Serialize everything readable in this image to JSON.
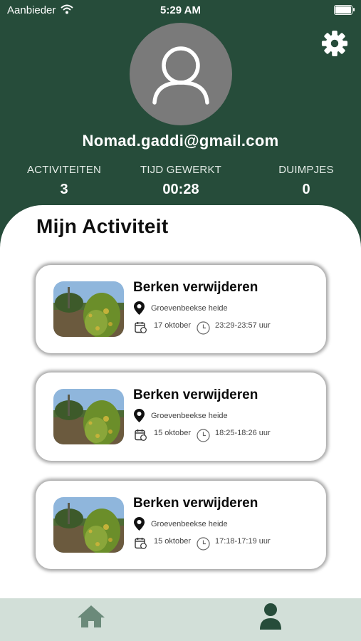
{
  "status_bar": {
    "carrier": "Aanbieder",
    "time": "5:29 AM",
    "battery_level": 0.9
  },
  "profile": {
    "email": "Nomad.gaddi@gmail.com",
    "stats": [
      {
        "label": "ACTIVITEITEN",
        "value": "3"
      },
      {
        "label": "TIJD GEWERKT",
        "value": "00:28"
      },
      {
        "label": "DUIMPJES",
        "value": "0"
      }
    ]
  },
  "section": {
    "title": "Mijn Activiteit"
  },
  "activities": [
    {
      "title": "Berken verwijderen",
      "location": "Groevenbeekse heide",
      "date": "17 oktober",
      "time_range": "23:29-23:57 uur"
    },
    {
      "title": "Berken verwijderen",
      "location": "Groevenbeekse heide",
      "date": "15 oktober",
      "time_range": "18:25-18:26 uur"
    },
    {
      "title": "Berken verwijderen",
      "location": "Groevenbeekse heide",
      "date": "15 oktober",
      "time_range": "17:18-17:19 uur"
    }
  ],
  "icons": {
    "settings": "gear-icon",
    "avatar": "person-icon",
    "location": "map-pin-icon",
    "date": "calendar-icon",
    "time": "clock-icon",
    "nav_home": "home-icon",
    "nav_profile": "person-icon"
  },
  "colors": {
    "primary_green": "#264c3a",
    "tabbar_bg": "#d2dfd8",
    "avatar_bg": "#7a7a7a"
  }
}
